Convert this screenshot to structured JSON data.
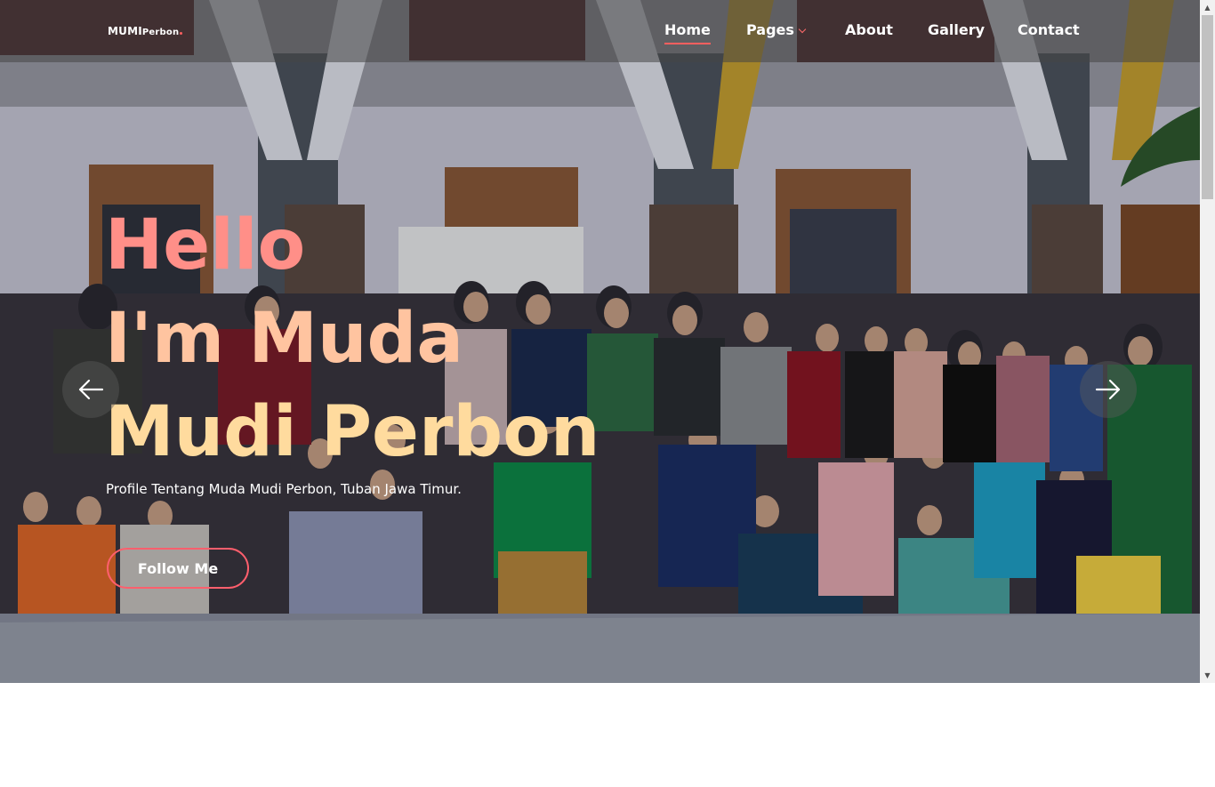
{
  "brand": {
    "name": "MUMI",
    "sub": "Perbon"
  },
  "nav": {
    "home": "Home",
    "pages": "Pages",
    "about": "About",
    "gallery": "Gallery",
    "contact": "Contact"
  },
  "hero": {
    "line1": "Hello",
    "line2": "I'm Muda",
    "line3": "Mudi Perbon",
    "subtitle": "Profile Tentang Muda Mudi Perbon, Tuban Jawa Timur.",
    "button": "Follow Me"
  },
  "colors": {
    "accent": "#ff5f6d",
    "title_line1": "#ff8f88",
    "title_line2": "#ffc4a0",
    "title_line3": "#ffdb9e"
  },
  "icons": {
    "prev": "arrow-left-icon",
    "next": "arrow-right-icon",
    "dropdown": "chevron-down-icon"
  }
}
